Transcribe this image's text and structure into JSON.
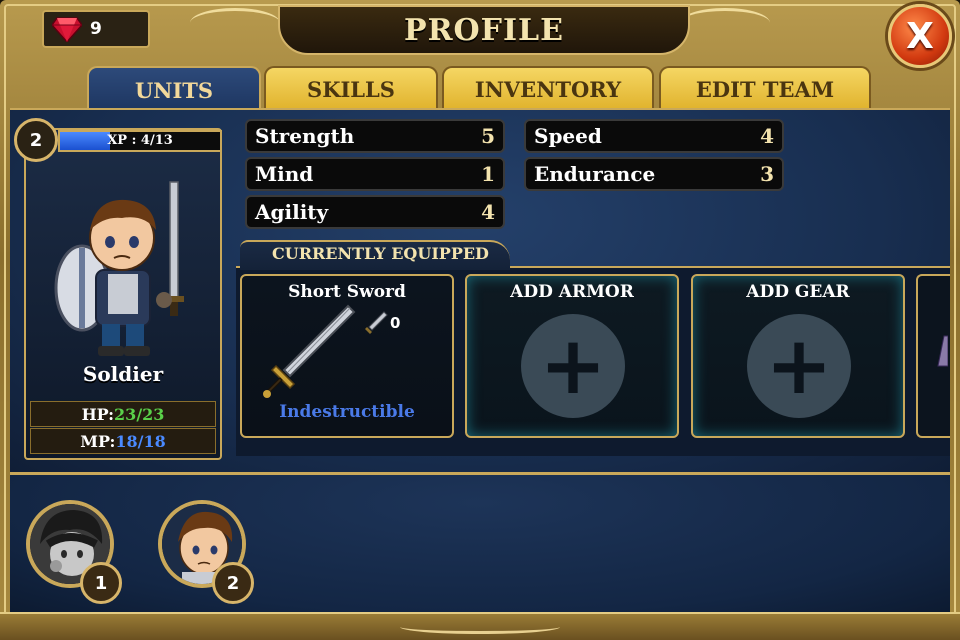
{
  "header": {
    "title": "PROFILE",
    "gems": "9",
    "close_label": "X"
  },
  "tabs": [
    {
      "label": "UNITS",
      "active": true
    },
    {
      "label": "SKILLS",
      "active": false
    },
    {
      "label": "INVENTORY",
      "active": false
    },
    {
      "label": "EDIT TEAM",
      "active": false
    }
  ],
  "unit": {
    "level": "2",
    "xp_text": "XP : 4/13",
    "xp_fraction": 0.31,
    "name": "Soldier",
    "hp_label": "HP:",
    "hp_value": "23/23",
    "mp_label": "MP:",
    "mp_value": "18/18"
  },
  "attributes": {
    "strength": {
      "label": "Strength",
      "value": "5"
    },
    "mind": {
      "label": "Mind",
      "value": "1"
    },
    "agility": {
      "label": "Agility",
      "value": "4"
    },
    "speed": {
      "label": "Speed",
      "value": "4"
    },
    "endurance": {
      "label": "Endurance",
      "value": "3"
    }
  },
  "equipment": {
    "section_title": "CURRENTLY EQUIPPED",
    "weapon": {
      "name": "Short Sword",
      "durability": "0",
      "status": "Indestructible"
    },
    "armor_slot": "ADD ARMOR",
    "gear_slot": "ADD GEAR"
  },
  "roster": [
    {
      "number": "1",
      "portrait": "hooded-rogue-portrait",
      "selected": false
    },
    {
      "number": "2",
      "portrait": "soldier-portrait",
      "selected": true
    }
  ],
  "colors": {
    "gold_trim": "#c9a85a",
    "panel_blue": "#182e50",
    "hp_green": "#5ad04a",
    "mp_blue": "#4a8aff",
    "status_blue": "#4a7ae8",
    "close_red": "#d23a10"
  }
}
